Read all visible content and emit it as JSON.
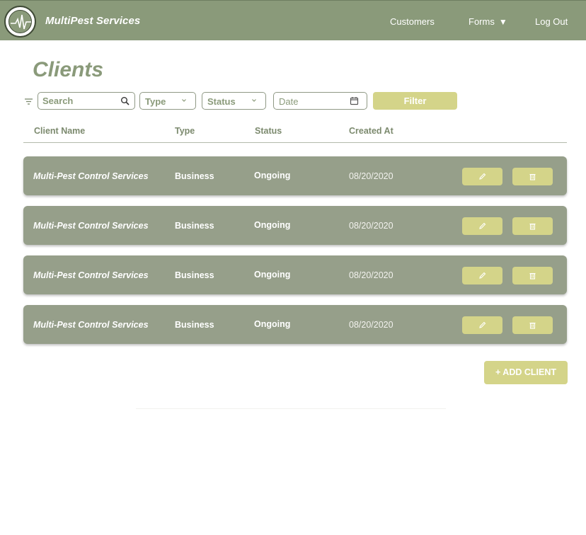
{
  "header": {
    "brand": "MultiPest Services",
    "nav": {
      "customers": "Customers",
      "forms": "Forms",
      "forms_caret": "▼",
      "logout": "Log Out"
    }
  },
  "page": {
    "title": "Clients"
  },
  "filters": {
    "search_placeholder": "Search",
    "type_label": "Type",
    "status_label": "Status",
    "date_label": "Date",
    "filter_button": "Filter"
  },
  "table": {
    "columns": [
      "Client Name",
      "Type",
      "Status",
      "Created At"
    ],
    "rows": [
      {
        "name": "Multi-Pest Control Services",
        "type": "Business",
        "status": "Ongoing",
        "created": "08/20/2020"
      },
      {
        "name": "Multi-Pest Control Services",
        "type": "Business",
        "status": "Ongoing",
        "created": "08/20/2020"
      },
      {
        "name": "Multi-Pest Control Services",
        "type": "Business",
        "status": "Ongoing",
        "created": "08/20/2020"
      },
      {
        "name": "Multi-Pest Control Services",
        "type": "Business",
        "status": "Ongoing",
        "created": "08/20/2020"
      }
    ]
  },
  "actions": {
    "add_client": "+ ADD CLIENT"
  },
  "icons": [
    "logo-icon",
    "filter-icon",
    "search-icon",
    "chevron-down-icon",
    "calendar-icon",
    "pencil-icon",
    "trash-icon"
  ],
  "colors": {
    "header": "#8a9a7a",
    "accent": "#d4d489",
    "row": "#969f8a",
    "title": "#8a9a7a"
  }
}
